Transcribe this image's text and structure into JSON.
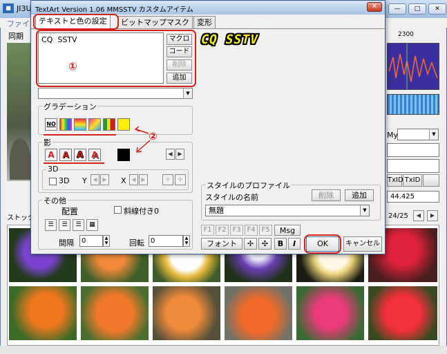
{
  "background_app": {
    "title": "JI3U",
    "menu_file": "ファイ",
    "sync_label": "同期",
    "freq_label": "2300",
    "my_label": "My",
    "txid_buttons": [
      "TxID",
      "TxID"
    ],
    "frequency": "44.425",
    "stock_label": "ストック画",
    "page_indicator": "24/25"
  },
  "dialog": {
    "title": "TextArt Version 1.06  MMSSTV カスタムアイテム",
    "close_glyph": "✕",
    "tabs": [
      "テキストと色の設定",
      "ビットマップマスク",
      "変形"
    ],
    "text_value": "CQ  SSTV",
    "side_buttons": {
      "macro": "マクロ",
      "code": "コード",
      "delete": "削除",
      "add": "追加"
    },
    "preview_text": "CQ SSTV",
    "gradation": {
      "label": "グラデーション",
      "no_button": "NO"
    },
    "shadow": {
      "label": "影",
      "letter": "A"
    },
    "three_d": {
      "label": "3D",
      "checkbox_label": "3D",
      "y_label": "Y",
      "x_label": "X"
    },
    "other": {
      "label": "その他",
      "layout_label": "配置",
      "slant_label": "斜線付き0",
      "spacing_label": "間隔",
      "spacing_value": "0",
      "rotation_label": "回転",
      "rotation_value": "0"
    },
    "style_profile": {
      "label": "スタイルのプロファイル",
      "name_label": "スタイルの名前",
      "delete": "削除",
      "add": "追加",
      "selected": "無題"
    },
    "f_buttons": [
      "F1",
      "F2",
      "F3",
      "F4",
      "F5"
    ],
    "msg_button": "Msg",
    "font_button": "フォント",
    "bold_button": "B",
    "italic_button": "I",
    "ok_button": "OK",
    "cancel_button": "キャンセル"
  },
  "annotations": {
    "mark1": "①",
    "mark2": "②"
  },
  "colors": {
    "accent_red": "#d2231a",
    "preview_yellow": "#f6ef20",
    "gradient_yellow": "#fff200"
  }
}
